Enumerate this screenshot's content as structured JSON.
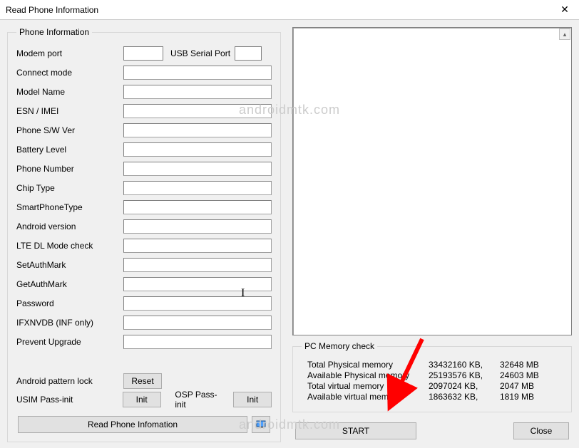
{
  "window": {
    "title": "Read Phone Information"
  },
  "groups": {
    "phone_info": "Phone Information",
    "pc_mem": "PC Memory check"
  },
  "fields": {
    "modem_port": "Modem port",
    "usb_serial": "USB Serial Port",
    "connect_mode": "Connect mode",
    "model_name": "Model Name",
    "esn_imei": "ESN / IMEI",
    "phone_sw": "Phone S/W Ver",
    "battery": "Battery Level",
    "phone_number": "Phone Number",
    "chip_type": "Chip Type",
    "smartphone_type": "SmartPhoneType",
    "android_ver": "Android version",
    "lte_dl": "LTE DL Mode check",
    "set_auth": "SetAuthMark",
    "get_auth": "GetAuthMark",
    "password": "Password",
    "ifxnvdb": "IFXNVDB (INF only)",
    "prevent_upgrade": "Prevent Upgrade",
    "android_pattern": "Android pattern lock",
    "usim_pass": "USIM Pass-init",
    "osp_pass": "OSP Pass-init"
  },
  "buttons": {
    "reset": "Reset",
    "init": "Init",
    "read_phone": "Read Phone Infomation",
    "start": "START",
    "close": "Close"
  },
  "pc_memory": {
    "rows": [
      {
        "label": "Total Physical memory",
        "kb": "33432160 KB,",
        "mb": "32648 MB"
      },
      {
        "label": "Available Physical memory",
        "kb": "25193576 KB,",
        "mb": "24603 MB"
      },
      {
        "label": "Total virtual memory",
        "kb": "2097024 KB,",
        "mb": "2047 MB"
      },
      {
        "label": "Available virtual memory",
        "kb": "1863632 KB,",
        "mb": "1819 MB"
      }
    ]
  },
  "watermark": "androidmtk.com",
  "close_glyph": "✕",
  "scroll_glyph": "▴"
}
